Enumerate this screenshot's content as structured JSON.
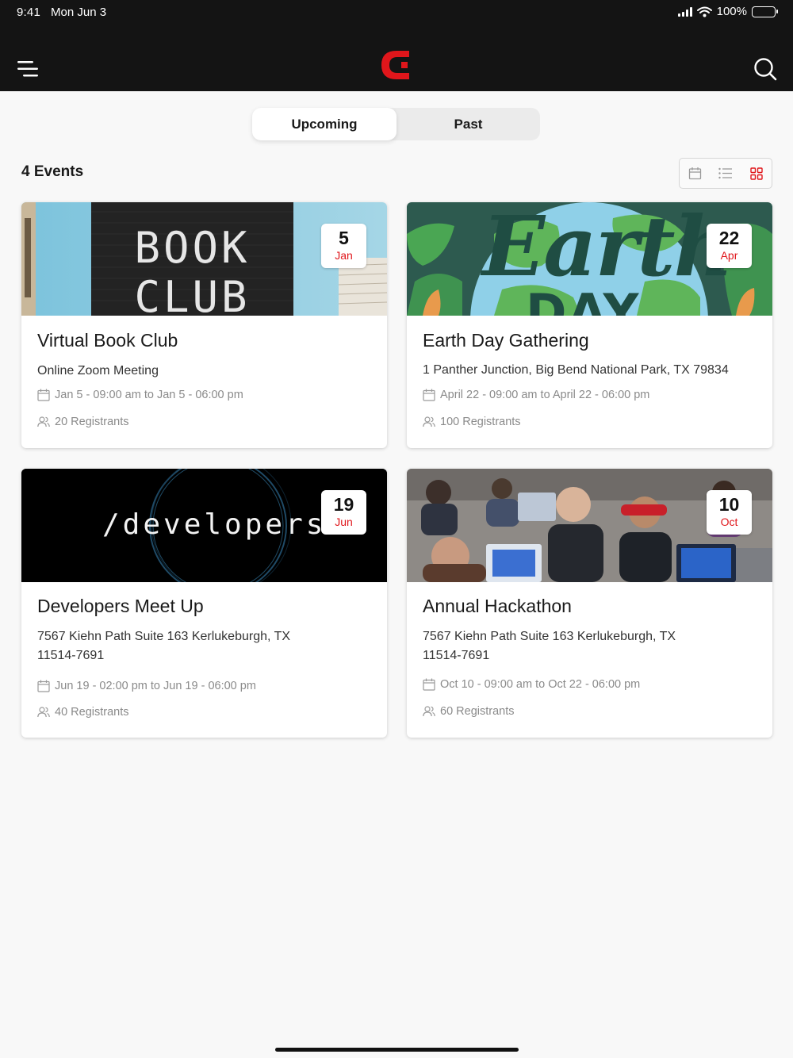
{
  "status": {
    "time": "9:41",
    "date": "Mon Jun 3",
    "battery": "100%"
  },
  "header": {
    "menu_icon": "menu-icon",
    "logo_icon": "brand-logo-icon",
    "search_icon": "search-icon"
  },
  "tabs": {
    "upcoming": "Upcoming",
    "past": "Past",
    "active": "Upcoming"
  },
  "events_count": "4 Events",
  "view_toggle": [
    "calendar-view-icon",
    "list-view-icon",
    "grid-view-icon"
  ],
  "events": [
    {
      "title": "Virtual Book Club",
      "day": "5",
      "month": "Jan",
      "location": "Online Zoom Meeting",
      "when": "Jan 5  - 09:00 am to Jan 5 - 06:00 pm",
      "registrants": "20 Registrants",
      "image_text": [
        "BOOK",
        "CLUB"
      ]
    },
    {
      "title": "Earth Day Gathering",
      "day": "22",
      "month": "Apr",
      "location": "1 Panther Junction, Big Bend National Park, TX 79834",
      "when": "April 22 - 09:00 am to April 22 - 06:00 pm",
      "registrants": "100 Registrants",
      "image_text": [
        "Earth",
        "DAY"
      ]
    },
    {
      "title": "Developers Meet Up",
      "day": "19",
      "month": "Jun",
      "location": "7567 Kiehn Path Suite 163 Kerlukeburgh, TX 11514-7691",
      "when": "Jun 19 - 02:00 pm to Jun 19 - 06:00 pm",
      "registrants": "40 Registrants",
      "image_text": [
        "/developers"
      ]
    },
    {
      "title": "Annual Hackathon",
      "day": "10",
      "month": "Oct",
      "location": "7567 Kiehn Path Suite 163 Kerlukeburgh, TX 11514-7691",
      "when": "Oct 10 - 09:00 am to Oct 22 - 06:00 pm",
      "registrants": "60 Registrants",
      "image_text": []
    }
  ],
  "colors": {
    "accent": "#e0161b",
    "topbar": "#141414",
    "background": "#f8f8f8"
  }
}
